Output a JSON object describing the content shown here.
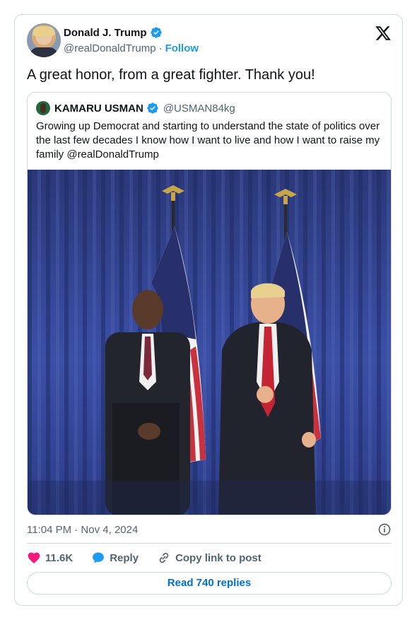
{
  "author": {
    "name": "Donald J. Trump",
    "handle": "@realDonaldTrump",
    "separator": "·",
    "follow_label": "Follow"
  },
  "tweet": {
    "text": "A great honor, from a great fighter. Thank you!",
    "timestamp": "11:04 PM · Nov 4, 2024"
  },
  "quoted": {
    "name": "KAMARU USMAN",
    "handle": "@USMAN84kg",
    "text": "Growing up Democrat and starting to understand the state of politics over the last few decades I know how I want to live and how I want to raise my family @realDonaldTrump"
  },
  "actions": {
    "likes": "11.6K",
    "reply_label": "Reply",
    "copy_label": "Copy link to post"
  },
  "read_replies_label": "Read 740 replies",
  "colors": {
    "accent": "#1d9bf0",
    "like": "#f91880",
    "link": "#006fd6",
    "border": "#cfd9de",
    "muted": "#536471"
  },
  "icons": [
    "verified-badge-icon",
    "x-logo-icon",
    "info-icon",
    "heart-icon",
    "reply-bubble-icon",
    "link-icon"
  ]
}
